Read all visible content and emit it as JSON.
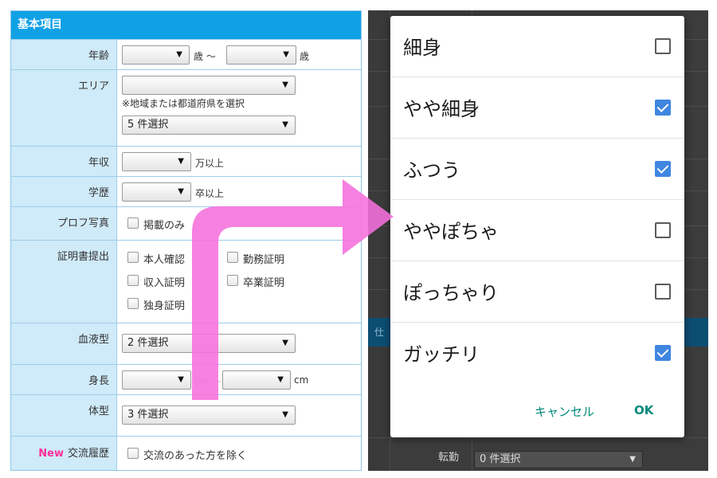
{
  "search_form": {
    "header": "基本項目",
    "age": {
      "label": "年齢",
      "unit_from": "歳 〜",
      "unit_to": "歳"
    },
    "area": {
      "label": "エリア",
      "hint": "※地域または都道府県を選択",
      "selected": "5 件選択"
    },
    "income": {
      "label": "年収",
      "unit": "万以上"
    },
    "education": {
      "label": "学歴",
      "unit": "卒以上"
    },
    "photo": {
      "label": "プロフ写真",
      "option": "掲載のみ"
    },
    "certificates": {
      "label": "証明書提出",
      "options": [
        "本人確認",
        "勤務証明",
        "収入証明",
        "卒業証明",
        "独身証明"
      ]
    },
    "blood_type": {
      "label": "血液型",
      "selected": "2 件選択"
    },
    "height": {
      "label": "身長",
      "unit_from": "cm 〜",
      "unit_to": "cm"
    },
    "body_type": {
      "label": "体型",
      "selected": "3 件選択"
    },
    "exchange_history": {
      "new_tag": "New",
      "label": "交流履歴",
      "option": "交流のあった方を除く"
    }
  },
  "background": {
    "band_text": "仕",
    "transfer_label": "転勤",
    "transfer_selected": "0 件選択"
  },
  "body_type_dialog": {
    "options": [
      {
        "label": "細身",
        "checked": false
      },
      {
        "label": "やや細身",
        "checked": true
      },
      {
        "label": "ふつう",
        "checked": true
      },
      {
        "label": "ややぽちゃ",
        "checked": false
      },
      {
        "label": "ぽっちゃり",
        "checked": false
      },
      {
        "label": "ガッチリ",
        "checked": true
      }
    ],
    "cancel_label": "キャンセル",
    "ok_label": "OK"
  },
  "colors": {
    "header_blue": "#10a1e5",
    "label_cell_blue": "#cfeaf8",
    "arrow_pink": "#f66fdc",
    "checkbox_blue": "#3f86e0",
    "dialog_button_teal": "#00897b"
  },
  "icons": {
    "dropdown": "triangle-down-icon",
    "arrow": "elbow-right-arrow-icon"
  }
}
